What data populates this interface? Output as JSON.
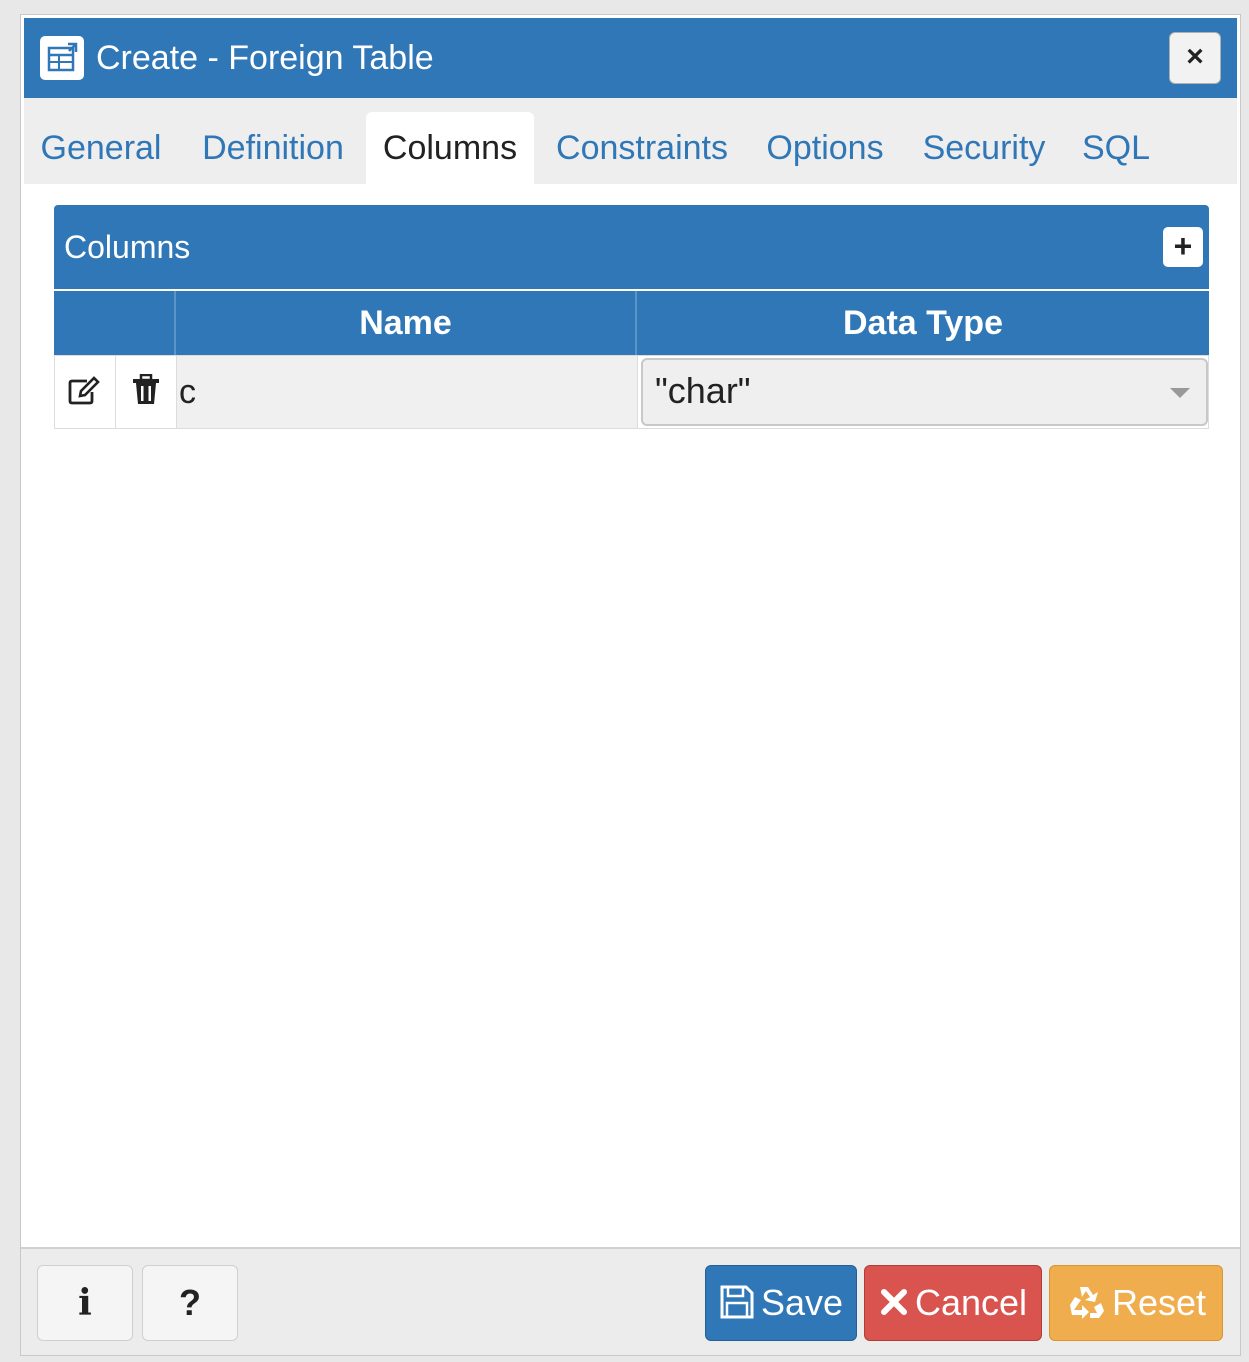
{
  "window": {
    "title": "Create - Foreign Table",
    "close_label": "×"
  },
  "tabs": [
    {
      "label": "General",
      "active": false
    },
    {
      "label": "Definition",
      "active": false
    },
    {
      "label": "Columns",
      "active": true
    },
    {
      "label": "Constraints",
      "active": false
    },
    {
      "label": "Options",
      "active": false
    },
    {
      "label": "Security",
      "active": false
    },
    {
      "label": "SQL",
      "active": false
    }
  ],
  "columns_panel": {
    "title": "Columns",
    "add_label": "+",
    "headers": {
      "name": "Name",
      "data_type": "Data Type"
    },
    "rows": [
      {
        "name": "c",
        "data_type": "\"char\""
      }
    ]
  },
  "footer": {
    "info_label": "i",
    "help_label": "?",
    "save_label": "Save",
    "cancel_label": "Cancel",
    "reset_label": "Reset"
  },
  "colors": {
    "primary": "#2f77b7",
    "danger": "#d9534f",
    "warning": "#f0ad4e"
  }
}
